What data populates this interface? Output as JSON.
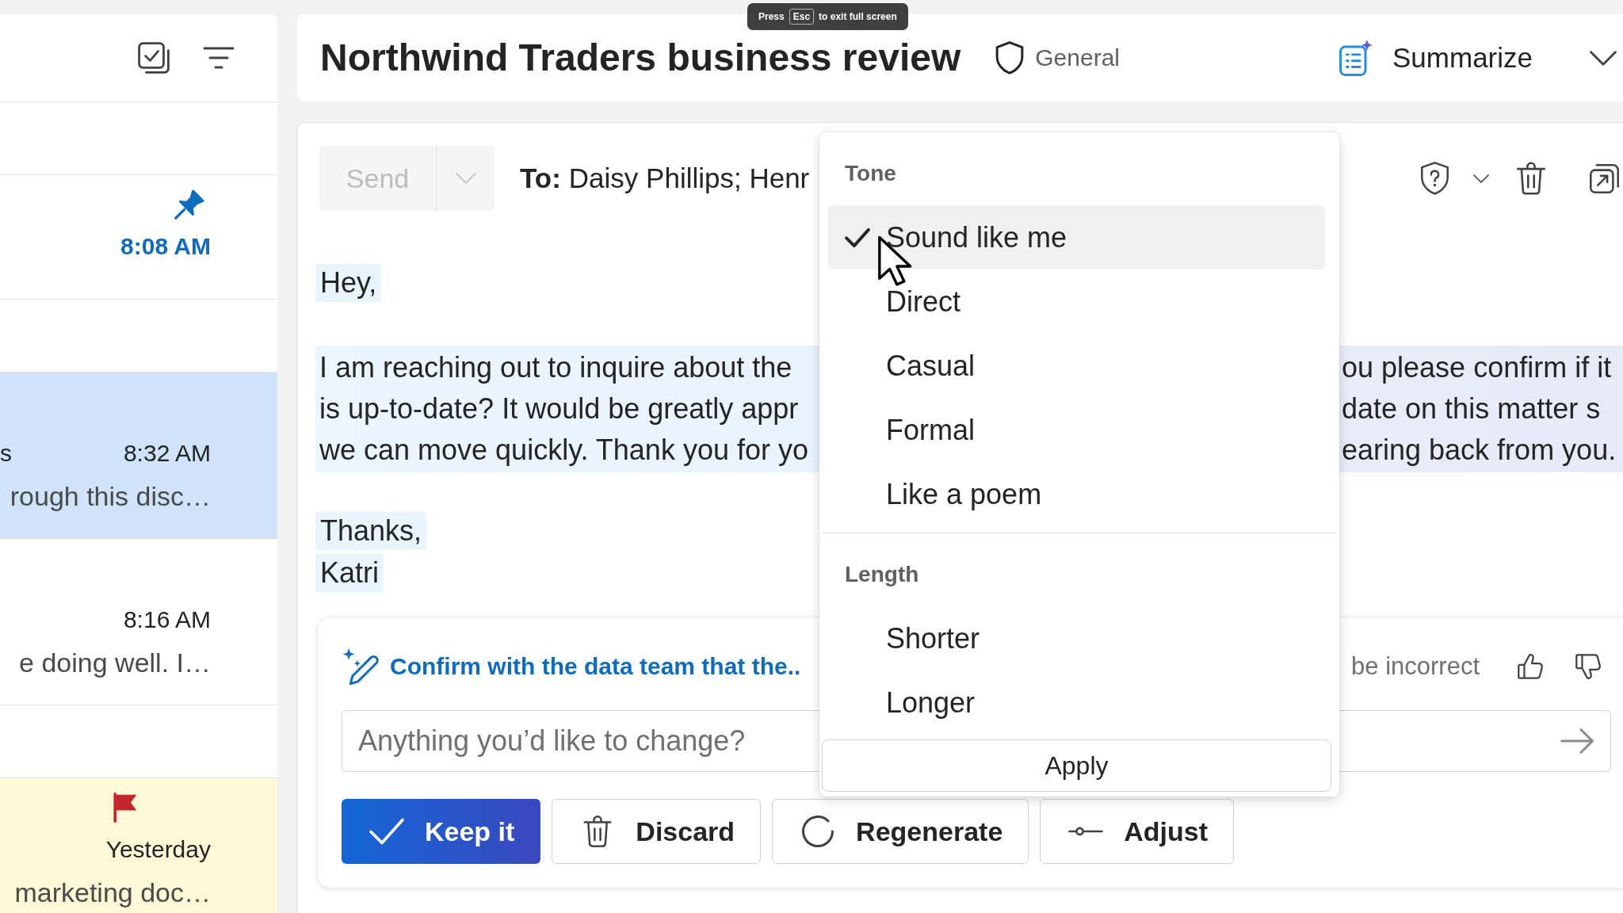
{
  "fullscreen_notice": {
    "before": "Press",
    "key": "Esc",
    "after": "to exit full screen"
  },
  "mail_list": {
    "items": [
      {
        "time": "8:08 AM",
        "unread": true,
        "pinned": true,
        "flagged": false,
        "selected": false
      },
      {
        "sender": "s",
        "time": "8:32 AM",
        "preview": "rough this disc…",
        "unread": false,
        "pinned": false,
        "flagged": false,
        "selected": true
      },
      {
        "time": "8:16 AM",
        "preview": "e doing well. I…",
        "unread": false,
        "pinned": false,
        "flagged": false,
        "selected": false
      },
      {
        "time": "Yesterday",
        "preview": "marketing doc…",
        "unread": false,
        "pinned": false,
        "flagged": true,
        "selected": false
      }
    ]
  },
  "reading_pane": {
    "subject": "Northwind Traders business review",
    "sensitivity": "General",
    "summarize": "Summarize"
  },
  "compose": {
    "send": {
      "label": "Send",
      "disabled": true
    },
    "to_label": "To:",
    "recipients": "Daisy Phillips; Henr",
    "greeting": "Hey,",
    "paragraph_lines": [
      {
        "left": "I am reaching out to inquire about the",
        "right": "ou please confirm if it"
      },
      {
        "left": "is up-to-date? It would be greatly appr",
        "right": "date on this matter s"
      },
      {
        "left": "we can move quickly. Thank you for yo",
        "right": "earing back from you."
      }
    ],
    "closing": [
      "Thanks,",
      "Katri"
    ]
  },
  "copilot": {
    "suggestion": "Confirm with the data team that the..",
    "disclaimer": "be incorrect",
    "input": {
      "placeholder": "Anything you’d like to change?"
    },
    "actions": [
      {
        "kind": "keep",
        "label": "Keep it"
      },
      {
        "kind": "discard",
        "label": "Discard"
      },
      {
        "kind": "regenerate",
        "label": "Regenerate"
      },
      {
        "kind": "adjust",
        "label": "Adjust"
      }
    ]
  },
  "tone_menu": {
    "sections": [
      {
        "title": "Tone",
        "options": [
          {
            "label": "Sound like me",
            "selected": true
          },
          {
            "label": "Direct",
            "selected": false
          },
          {
            "label": "Casual",
            "selected": false
          },
          {
            "label": "Formal",
            "selected": false
          },
          {
            "label": "Like a poem",
            "selected": false
          }
        ]
      },
      {
        "title": "Length",
        "options": [
          {
            "label": "Shorter",
            "selected": false
          },
          {
            "label": "Longer",
            "selected": false
          }
        ]
      }
    ],
    "apply": "Apply"
  }
}
